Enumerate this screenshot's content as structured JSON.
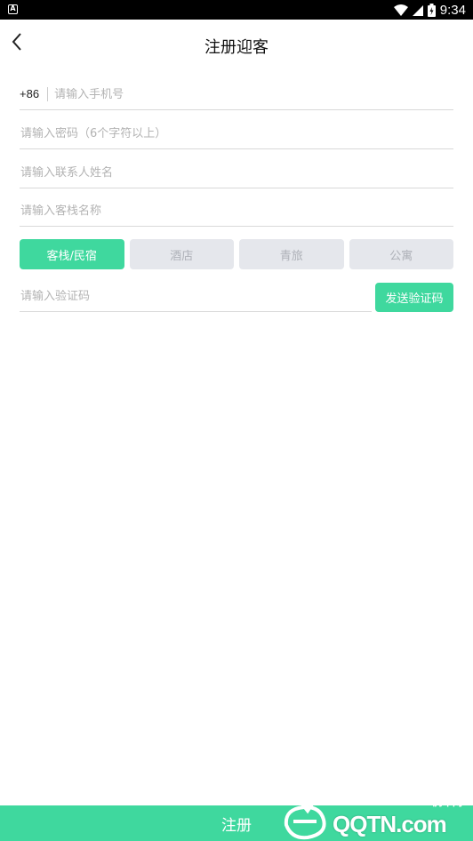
{
  "status_bar": {
    "time": "9:34",
    "app_icon": "A"
  },
  "header": {
    "title": "注册迎客"
  },
  "form": {
    "phone_prefix": "+86",
    "phone_placeholder": "请输入手机号",
    "password_placeholder": "请输入密码（6个字符以上）",
    "contact_placeholder": "请输入联系人姓名",
    "inn_placeholder": "请输入客栈名称",
    "types": [
      {
        "label": "客栈/民宿",
        "active": true
      },
      {
        "label": "酒店",
        "active": false
      },
      {
        "label": "青旅",
        "active": false
      },
      {
        "label": "公寓",
        "active": false
      }
    ],
    "code_placeholder": "请输入验证码",
    "send_code_label": "发送验证码"
  },
  "footer": {
    "register_label": "注册"
  },
  "watermark": {
    "small": "腾牛网",
    "big": "QQTN.com"
  },
  "colors": {
    "accent": "#3fd89e",
    "inactive_bg": "#e5e7ec",
    "inactive_text": "#aeb1b8"
  }
}
